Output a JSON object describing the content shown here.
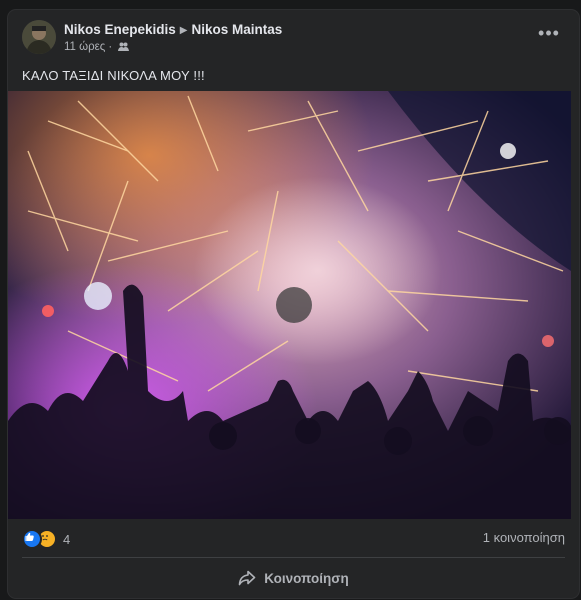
{
  "post": {
    "author": "Nikos Enepekidis",
    "recipient": "Nikos Maintas",
    "time": "11 ώρες",
    "audience_icon": "friends-icon",
    "text": "ΚΑΛΟ ΤΑΞΙΔΙ ΝΙΚΟΛΑ ΜΟΥ !!!",
    "more_label": "•••"
  },
  "reactions": {
    "icons": [
      "like-icon",
      "sad-icon"
    ],
    "count": "4"
  },
  "shares_label": "1 κοινοποίηση",
  "actions": {
    "share_label": "Κοινοποίηση"
  },
  "colors": {
    "background": "#18191a",
    "card": "#242526",
    "text": "#e4e6eb",
    "secondary_text": "#b0b3b8",
    "like": "#1877f2",
    "sad": "#f7b125"
  }
}
